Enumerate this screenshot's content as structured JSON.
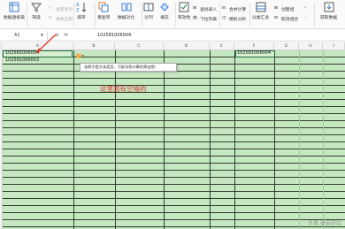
{
  "ribbon": {
    "group1": {
      "label": "数据透视表"
    },
    "group2": {
      "filter": "筛选",
      "show_all": "全部显示",
      "reapply": "重新应用"
    },
    "group3": {
      "sort": "排序"
    },
    "group4": {
      "repeat": "重复项",
      "compare": "数据对比"
    },
    "group5": {
      "text_to_cols": "分列",
      "fill": "填充"
    },
    "group6": {
      "find_entry": "查找录入",
      "valid": "有效性",
      "dropdown": "下拉列表"
    },
    "group7": {
      "merge_calc": "合并计算",
      "simulate": "模拟分析",
      "record": "记录单"
    },
    "group8": {
      "subtotal": "分类汇总",
      "create_group": "创建组",
      "cancel_group": "取消组合"
    },
    "group9": {
      "expand": "展开明细",
      "collapse": "折叠明细"
    },
    "group10": {
      "get_data": "获取数据"
    }
  },
  "formula_bar": {
    "name_box": "A1",
    "fx": "fx",
    "value": "102581006004"
  },
  "columns": [
    "A",
    "B",
    "C",
    "D",
    "E",
    "F",
    "G",
    "H",
    "I"
  ],
  "cells": {
    "a1": "102581006004",
    "a2": "102581006003",
    "f1": "102581006004"
  },
  "warning": {
    "icon": "!",
    "tooltip": "该数字是文本类型，可能导致计算结果出错！"
  },
  "annotation": "这里面有空格的",
  "watermark": "头条 @云办公"
}
